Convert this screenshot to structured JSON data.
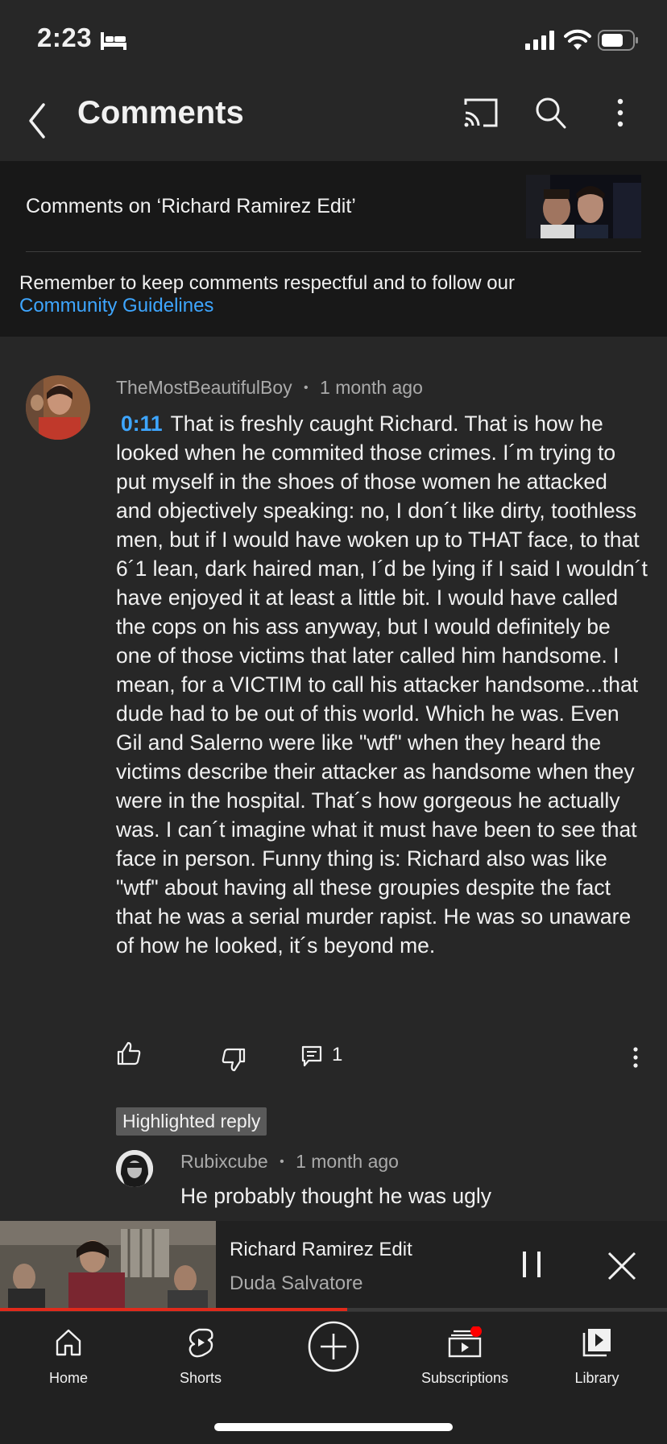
{
  "status_bar": {
    "time": "2:23",
    "icons": [
      "bed-icon",
      "signal-icon",
      "wifi-icon",
      "battery-icon"
    ]
  },
  "header": {
    "title": "Comments",
    "icons": [
      "back-icon",
      "cast-icon",
      "search-icon",
      "more-icon"
    ]
  },
  "video_context": {
    "title": "Comments on ‘Richard Ramirez Edit’",
    "guidelines_text": "Remember to keep comments respectful and to follow our",
    "guidelines_link": "Community Guidelines"
  },
  "comment": {
    "author": "TheMostBeautifulBoy",
    "time_ago": "1 month ago",
    "timestamp": "0:11",
    "text": "That is freshly caught Richard. That is how he looked when he commited those crimes. I´m trying to put myself in the shoes of those women he attacked and objectively speaking: no, I don´t like dirty, toothless men, but if I would have woken up to THAT face, to that 6´1 lean, dark haired man, I´d be lying if I said I wouldn´t have enjoyed it at least a little bit. I would have called the cops on his ass anyway, but I would definitely be one of those victims that later called him handsome. I mean, for a VICTIM to call his attacker handsome...that dude had to be out of this world. Which he was. Even Gil and Salerno were like \"wtf\" when they heard the victims describe their attacker as handsome when they were in the hospital. That´s how gorgeous he actually was. I can´t imagine what it must have been to see that face in person. Funny thing is: Richard also was like \"wtf\" about having all these groupies despite the fact that he was a serial murder rapist. He was so unaware of how he looked, it´s beyond me.",
    "reply_count": "1"
  },
  "highlighted_reply": {
    "badge": "Highlighted reply",
    "author": "Rubixcube",
    "time_ago": "1 month ago",
    "text": "He probably thought he was ugly"
  },
  "mini_player": {
    "title": "Richard Ramirez Edit",
    "channel": "Duda Salvatore",
    "progress_fraction": 0.52
  },
  "bottom_nav": {
    "items": [
      {
        "label": "Home",
        "icon": "home-icon"
      },
      {
        "label": "Shorts",
        "icon": "shorts-icon"
      },
      {
        "label": "",
        "icon": "create-icon"
      },
      {
        "label": "Subscriptions",
        "icon": "subscriptions-icon"
      },
      {
        "label": "Library",
        "icon": "library-icon"
      }
    ]
  },
  "colors": {
    "background": "#272727",
    "link": "#3ea6ff",
    "progress": "#e02a1b",
    "notification_dot": "#ff0000"
  }
}
